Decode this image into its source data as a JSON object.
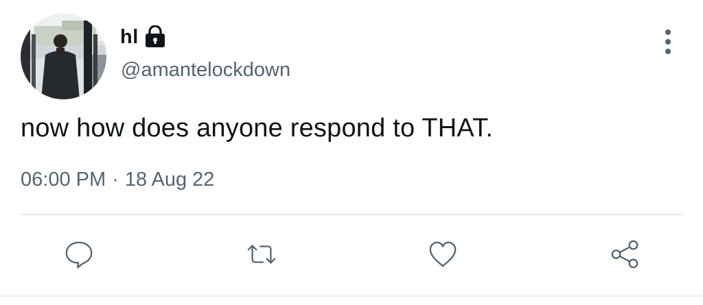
{
  "author": {
    "display_name": "hl",
    "handle": "@amantelockdown",
    "locked_icon": "lock-icon",
    "avatar_icon": "avatar-photo"
  },
  "tweet": {
    "text": "now how does anyone respond to THAT.",
    "time": "06:00 PM",
    "separator": "·",
    "date": "18 Aug 22"
  },
  "header": {
    "more_icon": "more-vertical-icon"
  },
  "actions": [
    {
      "name": "reply",
      "icon": "reply-icon"
    },
    {
      "name": "retweet",
      "icon": "retweet-icon"
    },
    {
      "name": "like",
      "icon": "heart-icon"
    },
    {
      "name": "share",
      "icon": "share-icon"
    }
  ],
  "colors": {
    "text_primary": "#0f1419",
    "text_secondary": "#536471",
    "divider": "#e6e9eb",
    "background": "#ffffff"
  }
}
